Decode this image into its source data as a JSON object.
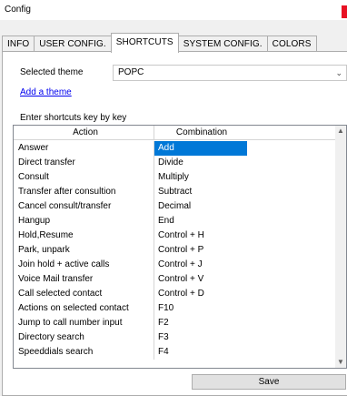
{
  "window": {
    "title": "Config"
  },
  "tabs": [
    {
      "label": "INFO",
      "active": false
    },
    {
      "label": "USER CONFIG.",
      "active": false
    },
    {
      "label": "SHORTCUTS",
      "active": true
    },
    {
      "label": "SYSTEM CONFIG.",
      "active": false
    },
    {
      "label": "COLORS",
      "active": false
    }
  ],
  "theme": {
    "label": "Selected theme",
    "value": "POPC",
    "add_link": "Add a theme"
  },
  "shortcuts": {
    "caption": "Enter shortcuts key by key",
    "columns": [
      "Action",
      "Combination"
    ],
    "rows": [
      {
        "action": "Answer",
        "combination": "Add",
        "selected": true
      },
      {
        "action": "Direct transfer",
        "combination": "Divide"
      },
      {
        "action": "Consult",
        "combination": "Multiply"
      },
      {
        "action": "Transfer after consultion",
        "combination": "Subtract"
      },
      {
        "action": "Cancel consult/transfer",
        "combination": "Decimal"
      },
      {
        "action": "Hangup",
        "combination": "End"
      },
      {
        "action": "Hold,Resume",
        "combination": "Control + H"
      },
      {
        "action": "Park, unpark",
        "combination": "Control + P"
      },
      {
        "action": "Join hold + active calls",
        "combination": "Control + J"
      },
      {
        "action": "Voice Mail transfer",
        "combination": "Control + V"
      },
      {
        "action": "Call selected contact",
        "combination": "Control + D"
      },
      {
        "action": "Actions on selected contact",
        "combination": "F10"
      },
      {
        "action": "Jump to call number input",
        "combination": "F2"
      },
      {
        "action": "Directory search",
        "combination": "F3"
      },
      {
        "action": "Speeddials search",
        "combination": "F4"
      }
    ]
  },
  "save_label": "Save",
  "colors": {
    "selection": "#0078d7",
    "link": "#0000ee",
    "close": "#e81123"
  },
  "icons": {
    "dropdown": "chevron-down-icon",
    "scroll_up": "scroll-up-icon",
    "scroll_down": "scroll-down-icon"
  }
}
